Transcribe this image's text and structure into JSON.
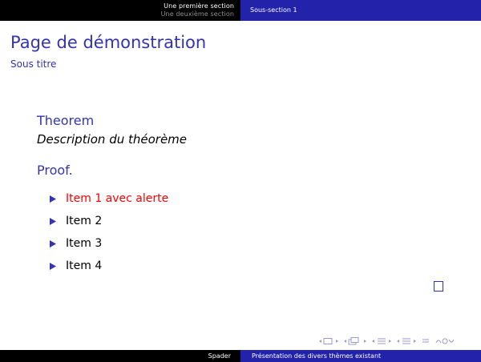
{
  "header": {
    "sections": [
      {
        "label": "Une première section",
        "current": true
      },
      {
        "label": "Une deuxième section",
        "current": false
      }
    ],
    "subsection": "Sous-section 1"
  },
  "frame": {
    "title": "Page de démonstration",
    "subtitle": "Sous titre"
  },
  "theorem": {
    "title": "Theorem",
    "body": "Description du théorème"
  },
  "proof": {
    "title": "Proof."
  },
  "items": [
    {
      "label": "Item 1 avec alerte",
      "alert": true
    },
    {
      "label": "Item 2",
      "alert": false
    },
    {
      "label": "Item 3",
      "alert": false
    },
    {
      "label": "Item 4",
      "alert": false
    }
  ],
  "footer": {
    "author": "Spader",
    "title": "Présentation des divers thèmes existant"
  },
  "colors": {
    "structure": "#3333b3",
    "alert": "#ff0000",
    "nav": "#9a9ad0"
  },
  "icons": [
    "bullet-triangle-icon",
    "qed-square-icon",
    "nav-frame-icon",
    "nav-subsection-icon",
    "nav-section-icon",
    "nav-document-icon",
    "nav-search-icon"
  ]
}
